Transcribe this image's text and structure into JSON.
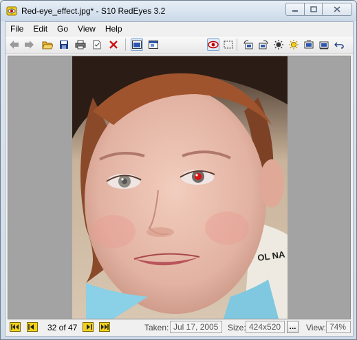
{
  "window": {
    "title": "Red-eye_effect.jpg* - S10 RedEyes 3.2"
  },
  "menu": [
    "File",
    "Edit",
    "Go",
    "View",
    "Help"
  ],
  "toolbar": {
    "buttons": [
      {
        "name": "back-arrow-icon"
      },
      {
        "name": "forward-arrow-icon"
      },
      {
        "name": "open-folder-icon"
      },
      {
        "name": "save-icon"
      },
      {
        "name": "print-icon"
      },
      {
        "name": "properties-icon"
      },
      {
        "name": "delete-icon"
      },
      {
        "name": "fit-window-icon"
      },
      {
        "name": "actual-size-icon"
      },
      {
        "name": "red-eye-tool-icon"
      },
      {
        "name": "selection-icon"
      },
      {
        "name": "rotate-left-icon"
      },
      {
        "name": "rotate-right-icon"
      },
      {
        "name": "brightness-down-icon"
      },
      {
        "name": "brightness-up-icon"
      },
      {
        "name": "contrast-icon"
      },
      {
        "name": "flip-icon"
      },
      {
        "name": "undo-icon"
      }
    ],
    "accent_color": "#c00000"
  },
  "status": {
    "position": "32 of 47",
    "taken_label": "Taken:",
    "taken_value": "Jul 17, 2005",
    "size_label": "Size:",
    "size_value": "424x520",
    "ellipsis": "...",
    "view_label": "View:",
    "view_value": "74%"
  },
  "photo": {
    "text_fragment": "OL NA"
  }
}
